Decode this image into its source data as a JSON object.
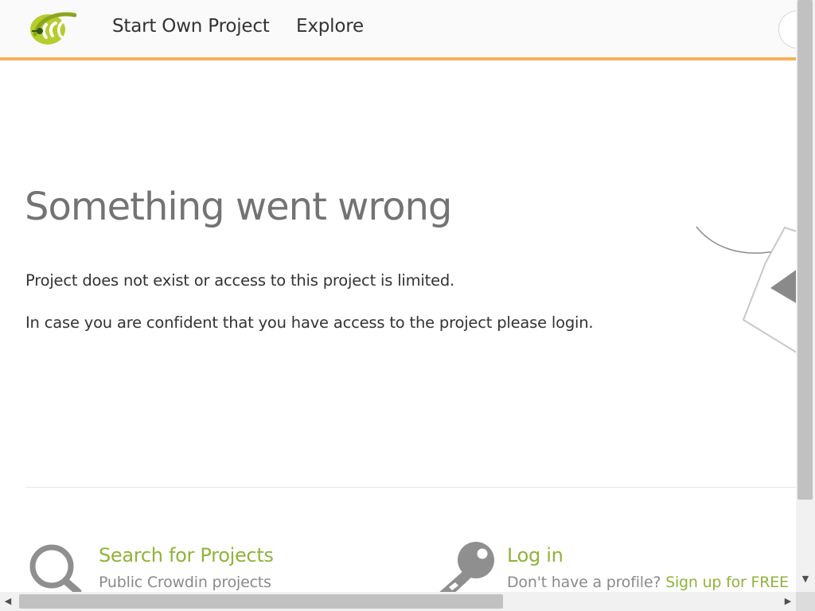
{
  "header": {
    "logo_icon": "crowdin-logo-icon",
    "nav": {
      "start_own_project": "Start Own Project",
      "explore": "Explore"
    },
    "accent_color": "#f4b35a"
  },
  "main": {
    "title": "Something went wrong",
    "message_line_1": "Project does not exist or access to this project is limited.",
    "message_line_2": "In case you are confident that you have access to the project please login."
  },
  "cards": {
    "search": {
      "icon": "magnifier-icon",
      "title": "Search for Projects",
      "subtitle": "Public Crowdin projects"
    },
    "login": {
      "icon": "key-icon",
      "title": "Log in",
      "subtitle_prefix": "Don't have a profile?",
      "signup_link": "Sign up for FREE"
    },
    "link_color": "#8fb33a"
  },
  "scrollbars": {
    "down_arrow": "▼",
    "left_arrow": "◀",
    "right_arrow": "▶"
  }
}
